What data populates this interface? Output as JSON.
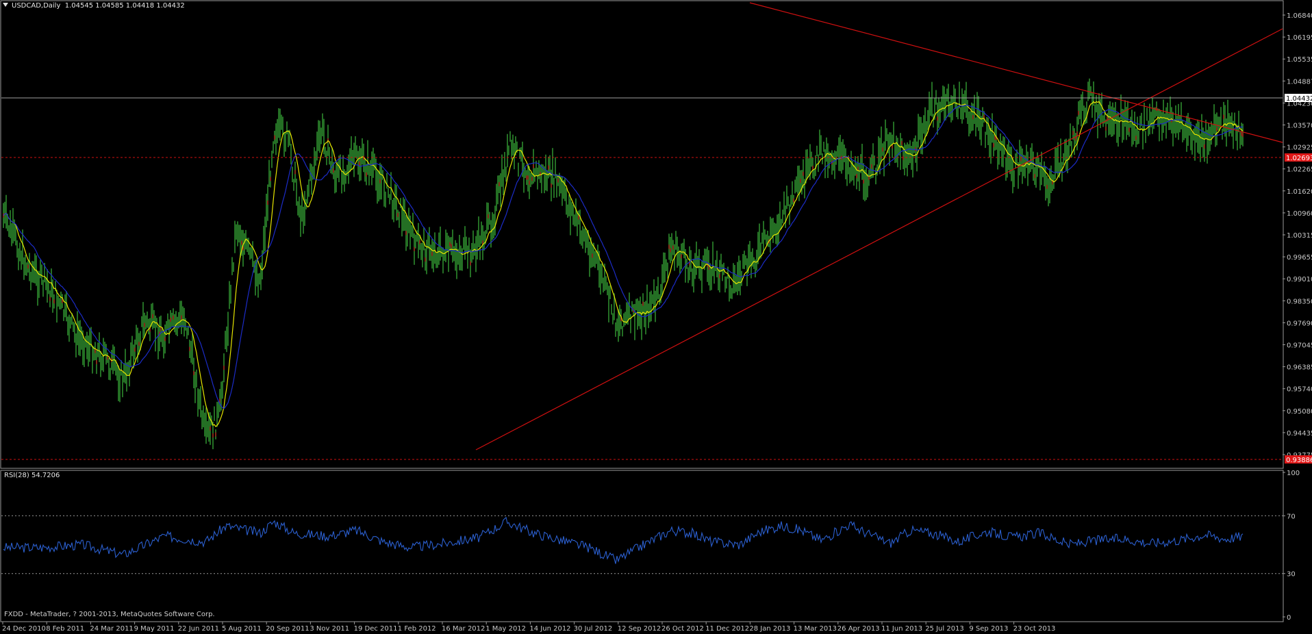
{
  "header": {
    "symbol_timeframe": "USDCAD,Daily",
    "ohlc": "1.04545 1.04585 1.04418 1.04432"
  },
  "indicator": {
    "label": "RSI(28) 54.7206"
  },
  "footer": {
    "text": "FXDD - MetaTrader, ? 2001-2013, MetaQuotes Software Corp."
  },
  "colors": {
    "background": "#000000",
    "candle": "#2e8b2e",
    "ma_fast": "#e6e600",
    "ma_slow": "#1c2cc8",
    "trendline": "#d01010",
    "rsi_line": "#2b5fcf",
    "price_tag": "#e01818",
    "grid_text": "#c8c8c8"
  },
  "price_axis": {
    "ticks": [
      "1.06840",
      "1.06195",
      "1.05535",
      "1.04887",
      "1.04230",
      "1.03570",
      "1.02925",
      "1.02265",
      "1.01620",
      "1.00960",
      "1.00315",
      "0.99655",
      "0.99010",
      "0.98350",
      "0.97690",
      "0.97045",
      "0.96385",
      "0.95740",
      "0.95080",
      "0.94435",
      "0.93775"
    ],
    "current_price_tag": "1.04432",
    "upper_level_tag": "1.02693",
    "lower_level_tag": "0.93886"
  },
  "rsi_axis": {
    "ticks": [
      "100",
      "70",
      "30",
      "0"
    ]
  },
  "time_axis": {
    "labels": [
      "24 Dec 2010",
      "8 Feb 2011",
      "24 Mar 2011",
      "9 May 2011",
      "22 Jun 2011",
      "5 Aug 2011",
      "20 Sep 2011",
      "3 Nov 2011",
      "19 Dec 2011",
      "1 Feb 2012",
      "16 Mar 2012",
      "1 May 2012",
      "14 Jun 2012",
      "30 Jul 2012",
      "12 Sep 2012",
      "26 Oct 2012",
      "11 Dec 2012",
      "28 Jan 2013",
      "13 Mar 2013",
      "26 Apr 2013",
      "11 Jun 2013",
      "25 Jul 2013",
      "9 Sep 2013",
      "23 Oct 2013"
    ]
  }
}
